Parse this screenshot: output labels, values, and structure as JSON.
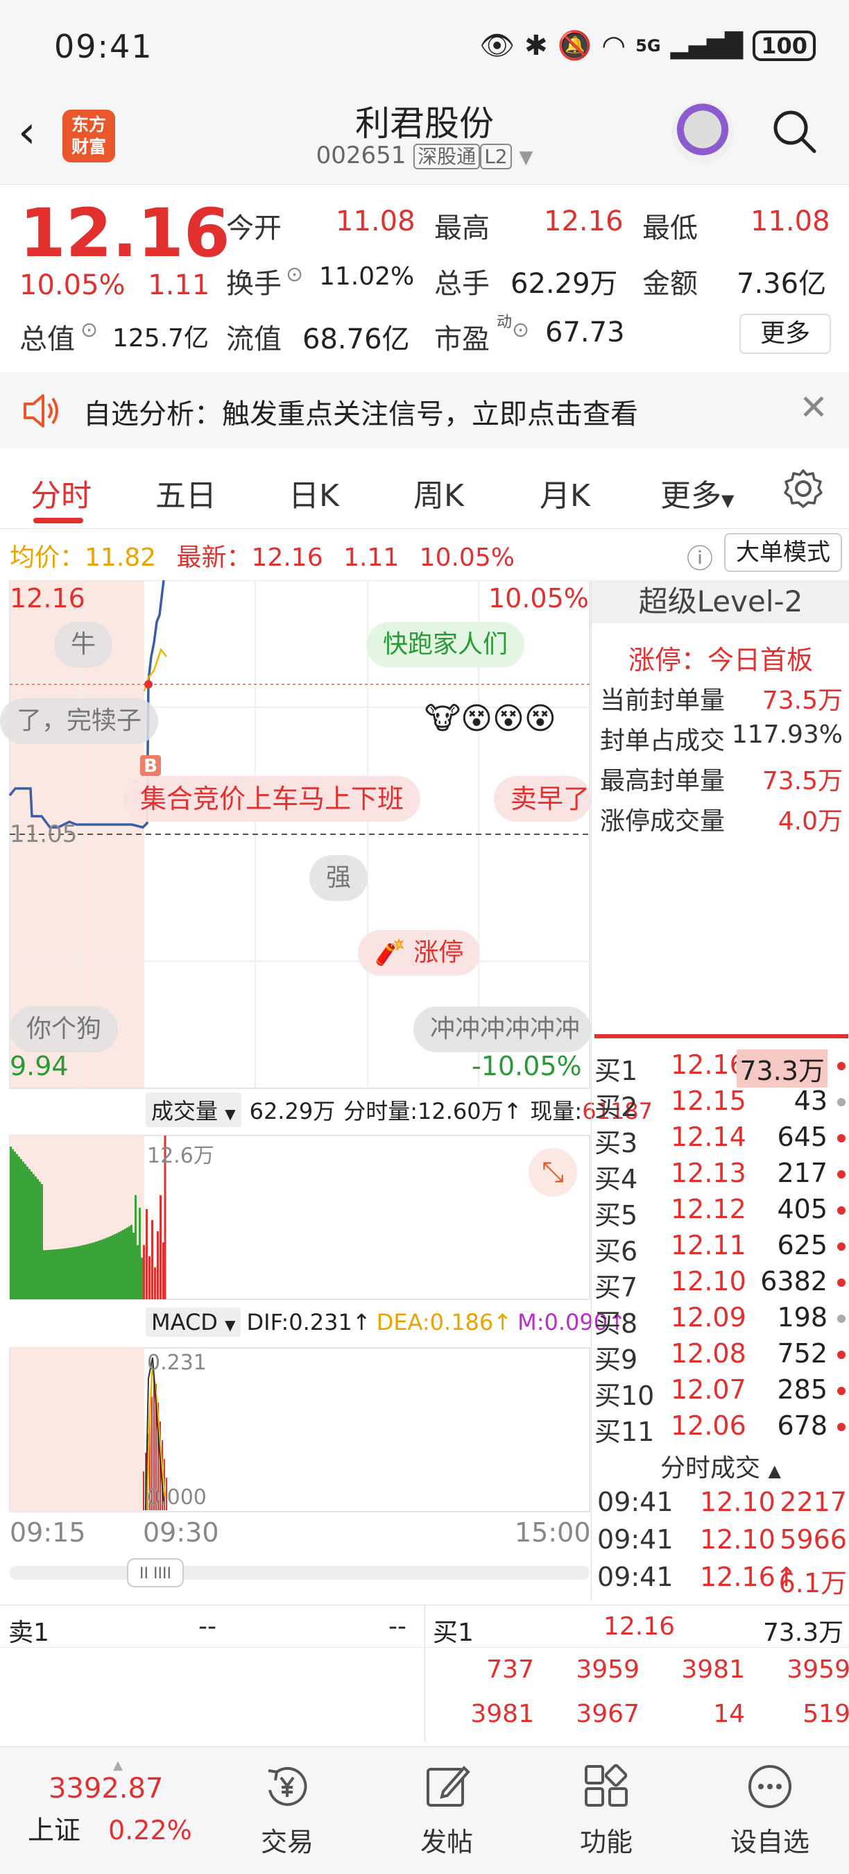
{
  "status_bar": {
    "time": "09:41",
    "battery": "100",
    "network": "5G"
  },
  "header": {
    "logo_line1": "东方",
    "logo_line2": "财富",
    "stock_name": "利君股份",
    "stock_code": "002651",
    "tag_market": "深股通",
    "tag_level": "L2"
  },
  "quote": {
    "price": "12.16",
    "change_pct": "10.05%",
    "change_amt": "1.11",
    "open_label": "今开",
    "open_value": "11.08",
    "high_label": "最高",
    "high_value": "12.16",
    "low_label": "最低",
    "low_value": "11.08",
    "turnover_label": "换手",
    "turnover_value": "11.02%",
    "volume_label": "总手",
    "volume_value": "62.29万",
    "amount_label": "金额",
    "amount_value": "7.36亿",
    "mktcap_label": "总值",
    "mktcap_value": "125.7亿",
    "float_label": "流值",
    "float_value": "68.76亿",
    "pe_label": "市盈",
    "pe_sup": "动",
    "pe_value": "67.73",
    "more_label": "更多"
  },
  "notice": {
    "text": "自选分析：触发重点关注信号，立即点击查看"
  },
  "tabs": [
    {
      "label": "分时"
    },
    {
      "label": "五日"
    },
    {
      "label": "日K"
    },
    {
      "label": "周K"
    },
    {
      "label": "月K"
    },
    {
      "label": "更多"
    }
  ],
  "info_row": {
    "avg_label": "均价：",
    "avg_value": "11.82",
    "latest_label": "最新：",
    "latest_value": "12.16",
    "latest_chg": "1.11",
    "latest_pct": "10.05%",
    "mode_label": "大单模式"
  },
  "chart": {
    "top_price": "12.16",
    "top_pct": "10.05%",
    "base_price": "11.05",
    "bottom_price": "9.94",
    "bottom_pct": "-10.05%",
    "bubbles": [
      "牛",
      "快跑家人们",
      "了，完犊子",
      "集合竞价上车马上下班",
      "卖早了",
      "强",
      "涨停",
      "你个狗",
      "冲冲冲冲冲冲"
    ],
    "volume_label": "成交量",
    "volume_total": "62.29万",
    "volume_min_label": "分时量:12.60万↑",
    "volume_now_label": "现量:",
    "volume_now_value": "61187",
    "volume_axis": "12.6万",
    "macd_label": "MACD",
    "dif": "DIF:0.231↑",
    "dea": "DEA:0.186↑",
    "m": "M:0.090↑",
    "macd_top": "0.231",
    "macd_bottom": "0.000",
    "time_start": "09:15",
    "time_mid": "09:30",
    "time_end": "15:00"
  },
  "level2": {
    "title": "超级Level-2",
    "limit_text": "涨停：今日首板",
    "rows": [
      {
        "label": "当前封单量",
        "value": "73.5万"
      },
      {
        "label": "封单占成交",
        "value": "117.93%"
      },
      {
        "label": "最高封单量",
        "value": "73.5万"
      },
      {
        "label": "涨停成交量",
        "value": "4.0万"
      }
    ],
    "bids": [
      {
        "label": "买1",
        "price": "12.16",
        "vol": "73.3万"
      },
      {
        "label": "买2",
        "price": "12.15",
        "vol": "43"
      },
      {
        "label": "买3",
        "price": "12.14",
        "vol": "645"
      },
      {
        "label": "买4",
        "price": "12.13",
        "vol": "217"
      },
      {
        "label": "买5",
        "price": "12.12",
        "vol": "405"
      },
      {
        "label": "买6",
        "price": "12.11",
        "vol": "625"
      },
      {
        "label": "买7",
        "price": "12.10",
        "vol": "6382"
      },
      {
        "label": "买8",
        "price": "12.09",
        "vol": "198"
      },
      {
        "label": "买9",
        "price": "12.08",
        "vol": "752"
      },
      {
        "label": "买10",
        "price": "12.07",
        "vol": "285"
      },
      {
        "label": "买11",
        "price": "12.06",
        "vol": "678"
      }
    ],
    "trades_title": "分时成交",
    "trades": [
      {
        "time": "09:41",
        "price": "12.10",
        "qty": "2217"
      },
      {
        "time": "09:41",
        "price": "12.10",
        "qty": "5966"
      },
      {
        "time": "09:41",
        "price": "12.16↑",
        "qty": "6.1万"
      }
    ]
  },
  "orders": {
    "sell_label": "卖1",
    "sell_price": "--",
    "sell_vol": "--",
    "buy_label": "买1",
    "buy_price": "12.16",
    "buy_vol": "73.3万",
    "queue_row1": [
      "737",
      "3959",
      "3981",
      "3959"
    ],
    "queue_row2": [
      "3981",
      "3967",
      "14",
      "519"
    ]
  },
  "bottom_nav": {
    "index_value": "3392.87",
    "index_name": "上证",
    "index_pct": "0.22%",
    "items": [
      {
        "label": "交易",
        "icon": "yen-icon"
      },
      {
        "label": "发帖",
        "icon": "edit-icon"
      },
      {
        "label": "功能",
        "icon": "grid-icon"
      },
      {
        "label": "设自选",
        "icon": "more-icon"
      }
    ]
  },
  "colors": {
    "up": "#e2302f",
    "down": "#2a9a35",
    "line": "#3a5fa8",
    "avg": "#f0b400"
  }
}
